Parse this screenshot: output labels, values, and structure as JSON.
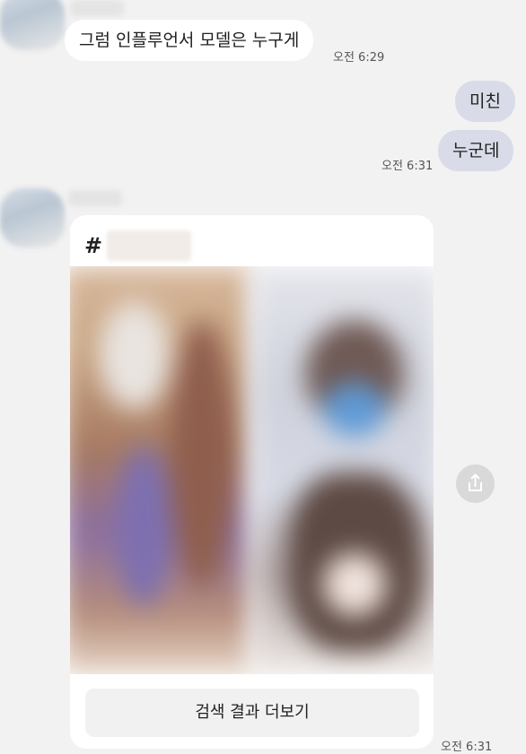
{
  "messages": {
    "first_in": {
      "text": "그럼 인플루언서 모델은 누구게",
      "time": "오전 6:29"
    },
    "out_1": {
      "text": "미친"
    },
    "out_2": {
      "text": "누군데",
      "time": "오전 6:31"
    }
  },
  "share_card": {
    "hash_symbol": "#",
    "more_button_label": "검색 결과 더보기",
    "time": "오전 6:31"
  },
  "icons": {
    "share": "share-icon",
    "avatar": "avatar"
  },
  "colors": {
    "background": "#f2f2f2",
    "incoming_bubble": "#ffffff",
    "outgoing_bubble": "#d9dce8",
    "share_button": "#d9d9d9"
  }
}
